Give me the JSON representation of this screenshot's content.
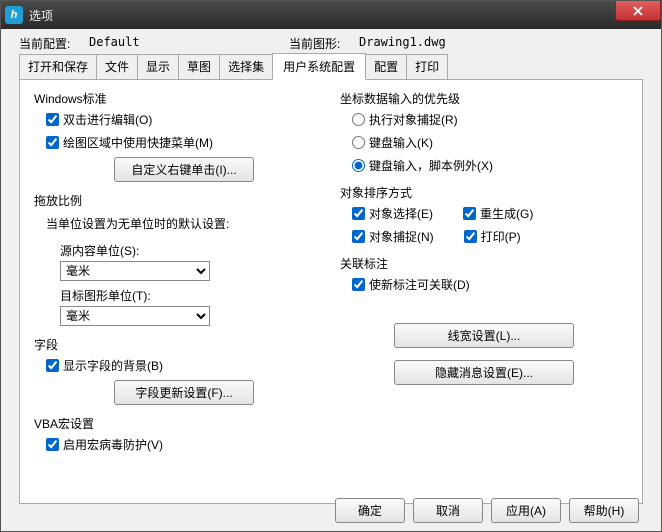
{
  "window": {
    "title": "选项"
  },
  "header": {
    "config_label": "当前配置:",
    "config_value": "Default",
    "drawing_label": "当前图形:",
    "drawing_value": "Drawing1.dwg"
  },
  "tabs": [
    "打开和保存",
    "文件",
    "显示",
    "草图",
    "选择集",
    "用户系统配置",
    "配置",
    "打印"
  ],
  "active_tab": 5,
  "left": {
    "win_std": {
      "title": "Windows标准",
      "chk_dblclick": "双击进行编辑(O)",
      "chk_context": "绘图区域中使用快捷菜单(M)",
      "btn_custom": "自定义右键单击(I)..."
    },
    "scale": {
      "title": "拖放比例",
      "desc": "当单位设置为无单位时的默认设置:",
      "src_label": "源内容单位(S):",
      "src_value": "毫米",
      "dst_label": "目标图形单位(T):",
      "dst_value": "毫米"
    },
    "field": {
      "title": "字段",
      "chk_bg": "显示字段的背景(B)",
      "btn_update": "字段更新设置(F)..."
    },
    "vba": {
      "title": "VBA宏设置",
      "chk_virus": "启用宏病毒防护(V)"
    }
  },
  "right": {
    "priority": {
      "title": "坐标数据输入的优先级",
      "r1": "执行对象捕捉(R)",
      "r2": "键盘输入(K)",
      "r3": "键盘输入，脚本例外(X)"
    },
    "sort": {
      "title": "对象排序方式",
      "c1": "对象选择(E)",
      "c2": "重生成(G)",
      "c3": "对象捕捉(N)",
      "c4": "打印(P)"
    },
    "assoc": {
      "title": "关联标注",
      "chk": "使新标注可关联(D)"
    },
    "btn_lw": "线宽设置(L)...",
    "btn_hide": "隐藏消息设置(E)..."
  },
  "footer": {
    "ok": "确定",
    "cancel": "取消",
    "apply": "应用(A)",
    "help": "帮助(H)"
  }
}
